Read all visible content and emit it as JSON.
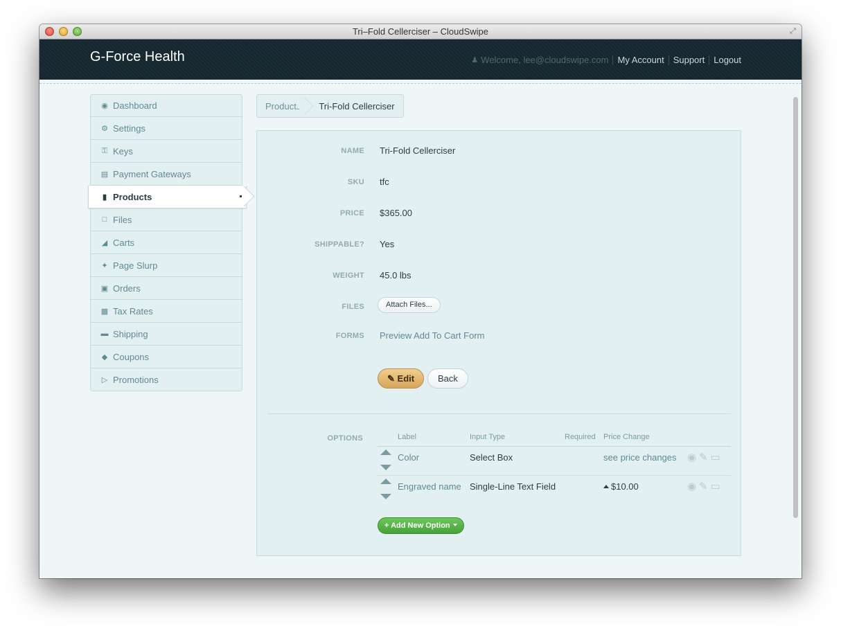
{
  "window": {
    "title": "Tri–Fold Cellerciser – CloudSwipe"
  },
  "header": {
    "brand": "G-Force Health",
    "welcome": "Welcome, lee@cloudswipe.com",
    "my_account": "My Account",
    "support": "Support",
    "logout": "Logout"
  },
  "sidebar": {
    "items": [
      {
        "label": "Dashboard",
        "icon": "dashboard-icon"
      },
      {
        "label": "Settings",
        "icon": "gear-icon"
      },
      {
        "label": "Keys",
        "icon": "key-icon"
      },
      {
        "label": "Payment Gateways",
        "icon": "credit-card-icon"
      },
      {
        "label": "Products",
        "icon": "barcode-icon",
        "active": true
      },
      {
        "label": "Files",
        "icon": "file-icon"
      },
      {
        "label": "Carts",
        "icon": "cart-icon"
      },
      {
        "label": "Page Slurp",
        "icon": "magic-wand-icon"
      },
      {
        "label": "Orders",
        "icon": "money-icon"
      },
      {
        "label": "Tax Rates",
        "icon": "book-icon"
      },
      {
        "label": "Shipping",
        "icon": "truck-icon"
      },
      {
        "label": "Coupons",
        "icon": "tags-icon"
      },
      {
        "label": "Promotions",
        "icon": "bullhorn-icon"
      }
    ]
  },
  "breadcrumb": {
    "parent": "Products",
    "current": "Tri-Fold Cellerciser"
  },
  "product": {
    "name_label": "NAME",
    "name": "Tri-Fold Cellerciser",
    "sku_label": "SKU",
    "sku": "tfc",
    "price_label": "PRICE",
    "price": "$365.00",
    "shippable_label": "SHIPPABLE?",
    "shippable": "Yes",
    "weight_label": "WEIGHT",
    "weight": "45.0 lbs",
    "files_label": "FILES",
    "attach_button": "Attach Files...",
    "forms_label": "FORMS",
    "forms_link": "Preview Add To Cart Form",
    "edit_button": "Edit",
    "back_button": "Back"
  },
  "options": {
    "section_label": "OPTIONS",
    "columns": {
      "label": "Label",
      "input_type": "Input Type",
      "required": "Required",
      "price_change": "Price Change"
    },
    "rows": [
      {
        "label": "Color",
        "input_type": "Select Box",
        "required": "",
        "price_change": "see price changes"
      },
      {
        "label": "Engraved name",
        "input_type": "Single-Line Text Field",
        "required": "",
        "price_change": "$10.00"
      }
    ],
    "add_button": "Add New Option"
  }
}
